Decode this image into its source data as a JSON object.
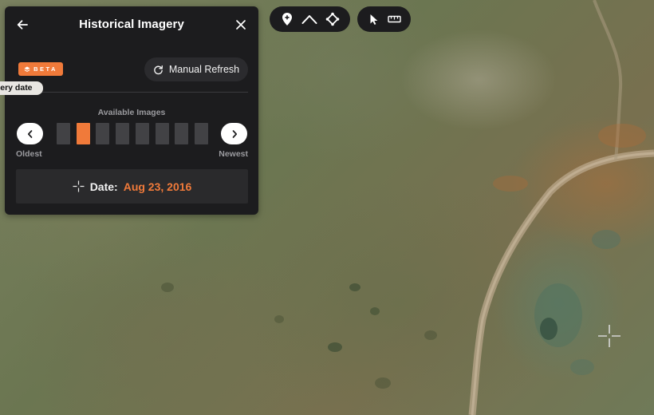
{
  "panel": {
    "title": "Historical Imagery",
    "beta_label": "BETA",
    "refresh_label": "Manual Refresh",
    "tooltip": "agery date",
    "available_label": "Available Images",
    "oldest_label": "Oldest",
    "newest_label": "Newest",
    "slots_total": 8,
    "selected_slot_index": 1,
    "date_label": "Date:",
    "date_value": "Aug 23, 2016"
  },
  "toolbar": {
    "draw_tools": [
      "map-pin-icon",
      "polyline-icon",
      "polygon-icon"
    ],
    "select_tools": [
      "pointer-icon",
      "ruler-icon"
    ]
  },
  "colors": {
    "accent": "#f07a3a",
    "panel_bg": "#1c1c1e",
    "slot_inactive": "#424245"
  }
}
